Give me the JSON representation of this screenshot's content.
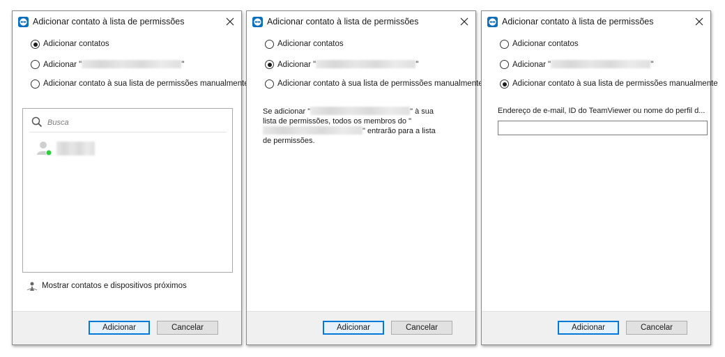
{
  "colors": {
    "accent": "#0078d7",
    "online": "#2ecc40",
    "footer_bg": "#f0f0f0"
  },
  "icons": {
    "app": "teamviewer-icon",
    "close": "close-icon",
    "search": "search-icon",
    "contact": "person-icon",
    "nearby": "nearby-icon"
  },
  "dialogs": [
    {
      "title": "Adicionar contato à lista de permissões",
      "options": [
        {
          "label": "Adicionar contatos",
          "checked": true
        },
        {
          "label_prefix": "Adicionar \"",
          "label_suffix": "\"",
          "checked": false
        },
        {
          "label": "Adicionar contato à sua lista de permissões manualmente",
          "checked": false
        }
      ],
      "search_placeholder": "Busca",
      "nearby_label": "Mostrar contatos e dispositivos próximos",
      "add_button": "Adicionar",
      "cancel_button": "Cancelar"
    },
    {
      "title": "Adicionar contato à lista de permissões",
      "options": [
        {
          "label": "Adicionar contatos",
          "checked": false
        },
        {
          "label_prefix": "Adicionar \"",
          "label_suffix": "\"",
          "checked": true
        },
        {
          "label": "Adicionar contato à sua lista de permissões manualmente",
          "checked": false
        }
      ],
      "info": {
        "part1": "Se adicionar \"",
        "part2": "\" à sua lista de permissões, todos os membros do \"",
        "part3": "\" entrarão para a lista de permissões."
      },
      "add_button": "Adicionar",
      "cancel_button": "Cancelar"
    },
    {
      "title": "Adicionar contato à lista de permissões",
      "options": [
        {
          "label": "Adicionar contatos",
          "checked": false
        },
        {
          "label_prefix": "Adicionar \"",
          "label_suffix": "\"",
          "checked": false
        },
        {
          "label": "Adicionar contato à sua lista de permissões manualmente",
          "checked": true
        }
      ],
      "field_label": "Endereço de e-mail, ID do TeamViewer ou nome do perfil d...",
      "field_value": "",
      "add_button": "Adicionar",
      "cancel_button": "Cancelar"
    }
  ]
}
